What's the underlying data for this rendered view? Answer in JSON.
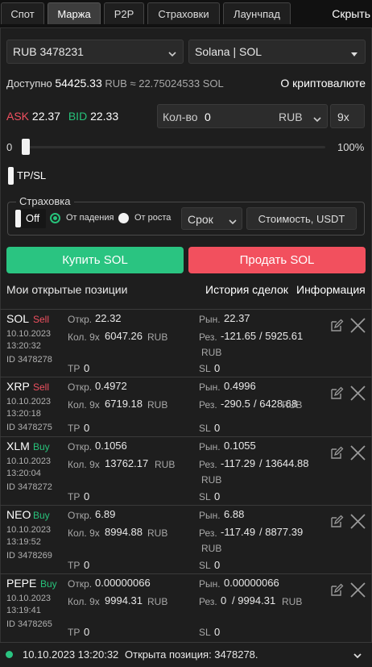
{
  "tabs": [
    {
      "label": "Спот"
    },
    {
      "label": "Маржа"
    },
    {
      "label": "P2P"
    },
    {
      "label": "Страховки"
    },
    {
      "label": "Лаунчпад"
    }
  ],
  "hide_label": "Скрыть",
  "account_select": "RUB 3478231",
  "asset_select": "Solana | SOL",
  "available": {
    "label": "Доступно",
    "value": "54425.33",
    "currency": "RUB",
    "approx": "≈ 22.75024533 SOL",
    "about_link": "О криптовалюте"
  },
  "quote": {
    "ask_label": "ASK",
    "ask_value": "22.37",
    "bid_label": "BID",
    "bid_value": "22.33",
    "qty_label": "Кол-во",
    "qty_value": "0",
    "qty_currency": "RUB",
    "leverage": "9x"
  },
  "slider": {
    "min_label": "0",
    "max_label": "100%",
    "value_percent": 0
  },
  "tpsl_label": "TP/SL",
  "insurance": {
    "legend": "Страховка",
    "toggle_label": "Off",
    "option_fall": "От падения",
    "option_rise": "От роста",
    "term_select": "Срок",
    "cost_button": "Стоимость, USDT"
  },
  "buy_button": "Купить SOL",
  "sell_button": "Продать SOL",
  "positions_header": {
    "title": "Мои открытые позиции",
    "history_link": "История сделок",
    "info_link": "Информация"
  },
  "labels": {
    "open": "Откр.",
    "qty": "Кол. 9x",
    "tp": "TP",
    "market": "Рын.",
    "result": "Рез.",
    "sl": "SL",
    "rub": "RUB"
  },
  "positions": [
    {
      "symbol": "SOL",
      "side": "Sell",
      "date": "10.10.2023",
      "time": "13:20:32",
      "id": "ID 3478278",
      "open": "22.32",
      "qty": "6047.26",
      "tp": "0",
      "market": "22.37",
      "pnl": "-121.65",
      "total": "/ 5925.61",
      "sl": "0"
    },
    {
      "symbol": "XRP",
      "side": "Sell",
      "date": "10.10.2023",
      "time": "13:20:18",
      "id": "ID 3478275",
      "open": "0.4972",
      "qty": "6719.18",
      "tp": "0",
      "market": "0.4996",
      "pnl": "-290.5",
      "total": "/ 6428.68",
      "sl": "0"
    },
    {
      "symbol": "XLM",
      "side": "Buy",
      "date": "10.10.2023",
      "time": "13:20:04",
      "id": "ID 3478272",
      "open": "0.1056",
      "qty": "13762.17",
      "tp": "0",
      "market": "0.1055",
      "pnl": "-117.29",
      "total": "/ 13644.88",
      "sl": "0"
    },
    {
      "symbol": "NEO",
      "side": "Buy",
      "date": "10.10.2023",
      "time": "13:19:52",
      "id": "ID 3478269",
      "open": "6.89",
      "qty": "8994.88",
      "tp": "0",
      "market": "6.88",
      "pnl": "-117.49",
      "total": "/ 8877.39",
      "sl": "0"
    },
    {
      "symbol": "PEPE",
      "side": "Buy",
      "date": "10.10.2023",
      "time": "13:19:41",
      "id": "ID 3478265",
      "open": "0.00000066",
      "qty": "9994.31",
      "tp": "0",
      "market": "0.00000066",
      "pnl": "0",
      "total": "/ 9994.31",
      "sl": "0"
    }
  ],
  "footer": {
    "timestamp": "10.10.2023 13:20:32",
    "message": "Открыта позиция: 3478278."
  },
  "colors": {
    "buy": "#2ac481",
    "sell": "#f2505e",
    "background": "#1e1e1e"
  }
}
